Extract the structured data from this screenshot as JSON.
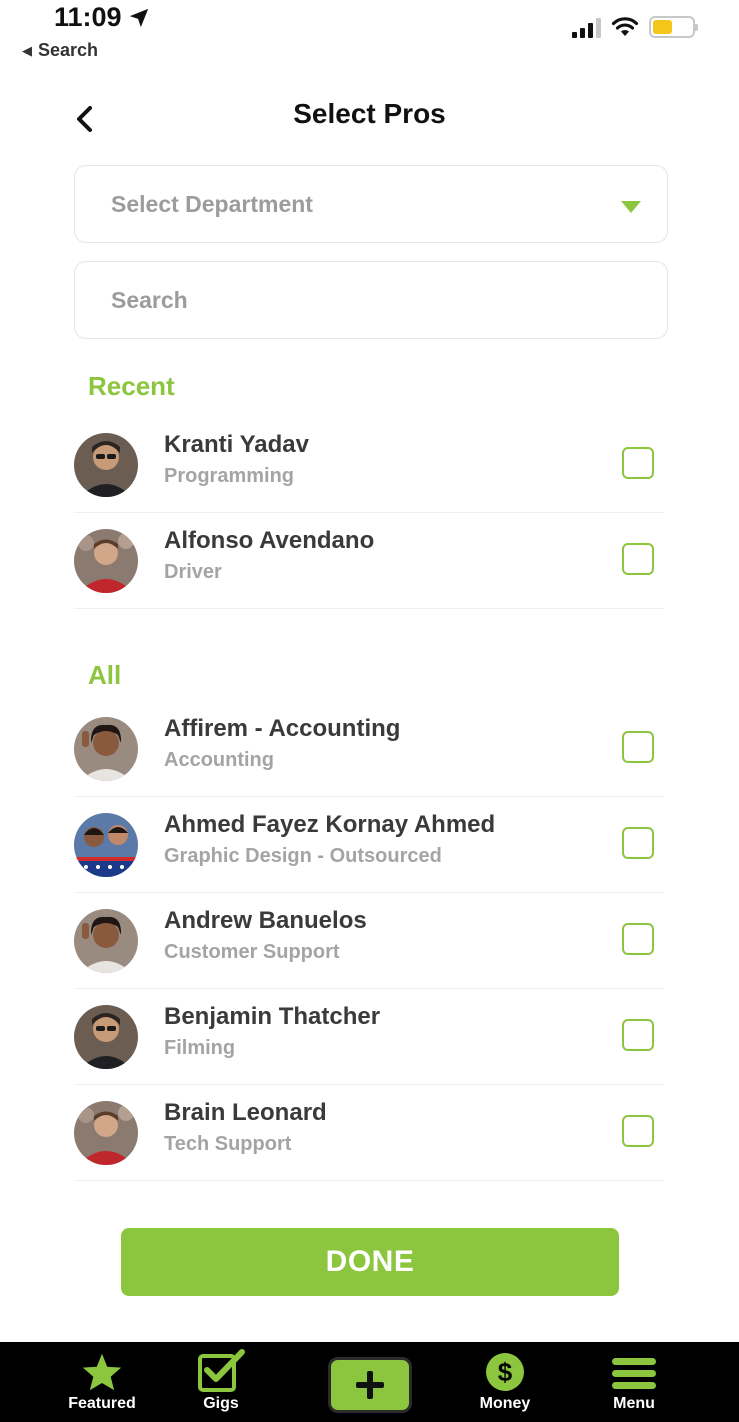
{
  "status_bar": {
    "time": "11:09",
    "back_label": "Search"
  },
  "header": {
    "title": "Select Pros"
  },
  "filters": {
    "department_placeholder": "Select Department",
    "search_placeholder": "Search"
  },
  "sections": {
    "recent_title": "Recent",
    "all_title": "All"
  },
  "recent": [
    {
      "name": "Kranti Yadav",
      "department": "Programming"
    },
    {
      "name": "Alfonso Avendano",
      "department": "Driver"
    }
  ],
  "all": [
    {
      "name": "Affirem - Accounting",
      "department": "Accounting"
    },
    {
      "name": "Ahmed Fayez Kornay Ahmed",
      "department": "Graphic Design - Outsourced"
    },
    {
      "name": "Andrew Banuelos",
      "department": "Customer Support"
    },
    {
      "name": "Benjamin Thatcher",
      "department": "Filming"
    },
    {
      "name": "Brain Leonard",
      "department": "Tech Support"
    }
  ],
  "done_label": "DONE",
  "tab_bar": {
    "featured": "Featured",
    "gigs": "Gigs",
    "money": "Money",
    "menu": "Menu"
  },
  "colors": {
    "accent": "#8cc63f",
    "tab_bar_bg": "#000000"
  }
}
